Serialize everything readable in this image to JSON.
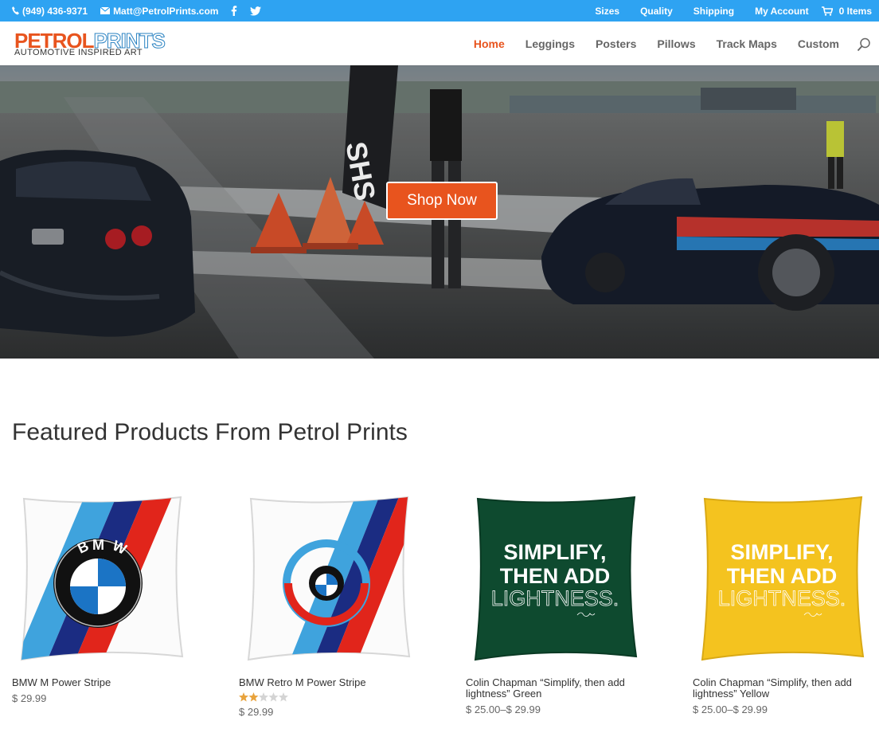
{
  "topbar": {
    "phone": "(949) 436-9371",
    "email": "Matt@PetrolPrints.com",
    "links": [
      "Sizes",
      "Quality",
      "Shipping",
      "My Account"
    ],
    "cart": "0 Items"
  },
  "header": {
    "logo_main_1": "PETROL",
    "logo_main_2": "PRINTS",
    "logo_tagline": "AUTOMOTIVE INSPIRED ART",
    "nav": [
      "Home",
      "Leggings",
      "Posters",
      "Pillows",
      "Track Maps",
      "Custom"
    ]
  },
  "hero": {
    "button": "Shop Now"
  },
  "featured": {
    "title": "Featured Products From Petrol Prints",
    "products": [
      {
        "name": "BMW M Power Stripe",
        "price": "$ 29.99",
        "rating": 0
      },
      {
        "name": "BMW Retro M Power Stripe",
        "price": "$ 29.99",
        "rating": 2
      },
      {
        "name": "Colin Chapman “Simplify, then add lightness” Green",
        "price": "$ 25.00–$ 29.99",
        "rating": 0
      },
      {
        "name": "Colin Chapman “Simplify, then add lightness” Yellow",
        "price": "$ 25.00–$ 29.99",
        "rating": 0
      }
    ],
    "pillow_quote_1": "SIMPLIFY,",
    "pillow_quote_2": "THEN ADD",
    "pillow_quote_3": "LIGHTNESS.",
    "bmw_letters": "BMW"
  },
  "colors": {
    "topbar": "#2ea3f2",
    "accent": "#e8541e",
    "green_pillow": "#0e4a2f",
    "yellow_pillow": "#f4c31f"
  }
}
